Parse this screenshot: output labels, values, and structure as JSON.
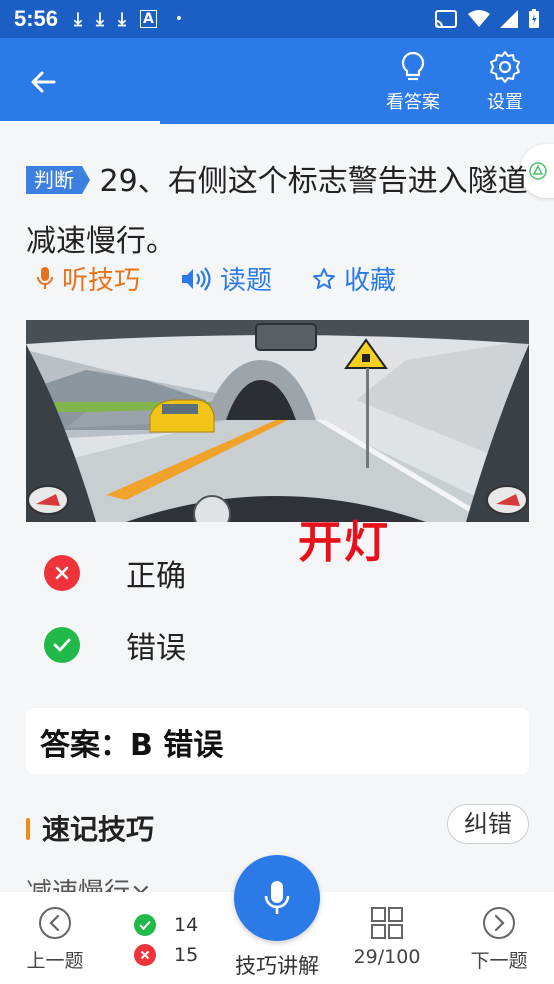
{
  "status_bar": {
    "time": "5:56",
    "download_icons": [
      "⤓",
      "⤓",
      "⤓"
    ],
    "extra": "A",
    "dot": "•"
  },
  "header": {
    "show_answer_label": "看答案",
    "settings_label": "设置"
  },
  "question": {
    "tag": "判断",
    "text": "29、右侧这个标志警告进入隧道减速慢行。"
  },
  "actions": {
    "tip": "听技巧",
    "read": "读题",
    "favorite": "收藏"
  },
  "image_overlay_text": "开灯",
  "options": [
    {
      "label": "正确",
      "state": "wrong"
    },
    {
      "label": "错误",
      "state": "correct"
    }
  ],
  "answer": {
    "text": "答案：B 错误"
  },
  "tips": {
    "title": "速记技巧",
    "report_label": "纠错",
    "preview": "减速慢行×"
  },
  "bottom_nav": {
    "prev_label": "上一题",
    "correct_count": "14",
    "wrong_count": "15",
    "explain_label": "技巧讲解",
    "progress": "29/100",
    "next_label": "下一题"
  },
  "colors": {
    "primary": "#2b7ae8",
    "status_bar": "#1c5fc4",
    "wrong": "#f0323a",
    "correct": "#21b94a",
    "tip_orange": "#e8731c",
    "overlay_red": "#e8101a"
  }
}
